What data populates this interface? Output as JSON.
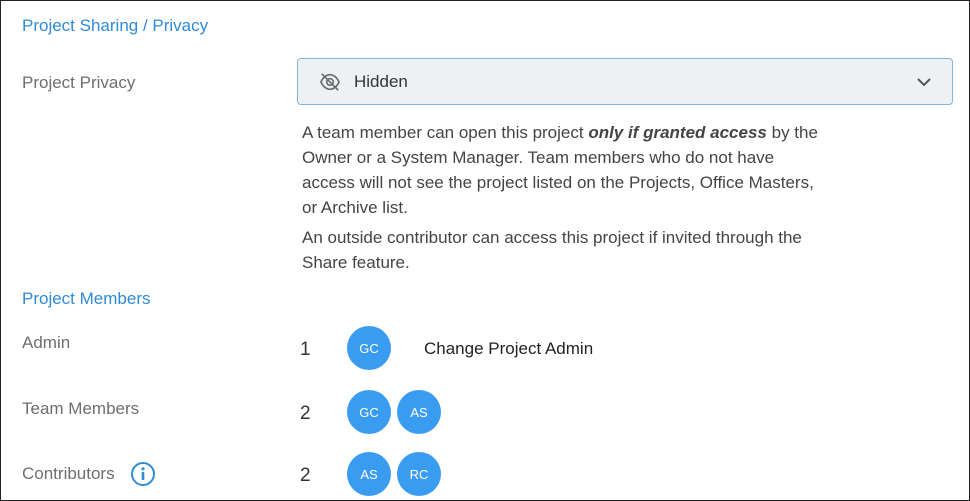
{
  "sharing": {
    "section_title": "Project Sharing / Privacy",
    "privacy_label": "Project Privacy",
    "privacy_select": {
      "value": "Hidden",
      "icon": "eye-off-icon"
    },
    "description_line1_prefix": "A team member can open this project ",
    "description_line1_emph": "only if granted access",
    "description_line1_suffix": " by the Owner or a System Manager. Team members who do not have access will not see the project listed on the Projects, Office Masters, or Archive list.",
    "description_line2": "An outside contributor can access this project if invited through the Share feature."
  },
  "members": {
    "section_title": "Project Members",
    "admin": {
      "label": "Admin",
      "count": "1",
      "avatars": [
        "GC"
      ],
      "action_label": "Change Project Admin"
    },
    "team": {
      "label": "Team Members",
      "count": "2",
      "avatars": [
        "GC",
        "AS"
      ]
    },
    "contributors": {
      "label": "Contributors",
      "count": "2",
      "avatars": [
        "AS",
        "RC"
      ],
      "info_icon": "info-icon"
    }
  },
  "colors": {
    "accent": "#2e8bd8",
    "avatar": "#3a9cf1",
    "select_bg": "#eef1f3",
    "select_border": "#7fb6e0"
  }
}
